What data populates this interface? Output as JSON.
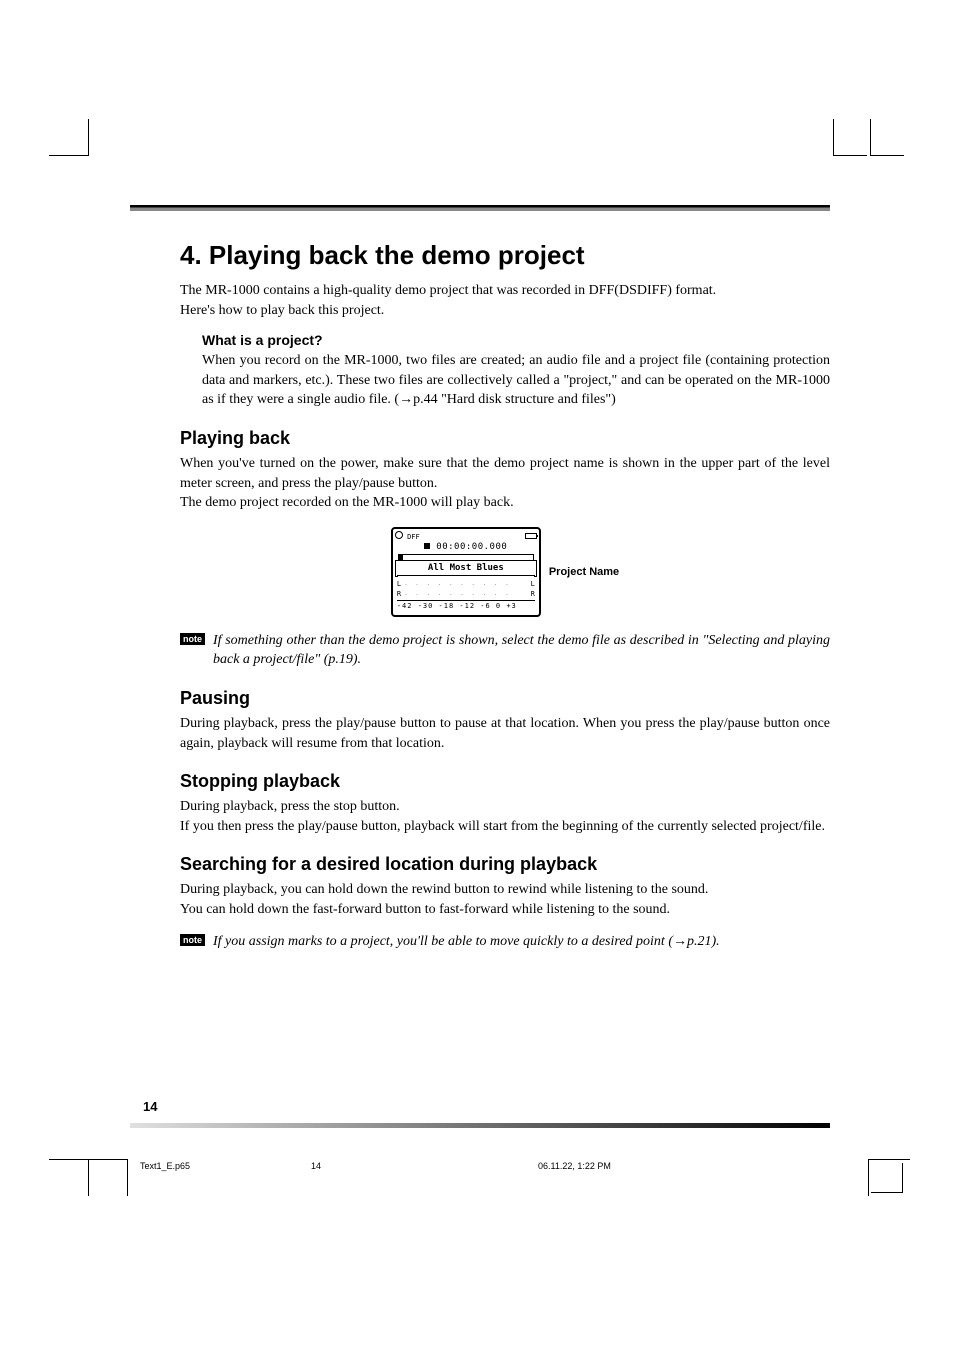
{
  "page": {
    "title": "4. Playing back the demo project",
    "intro_p1": "The MR-1000 contains a high-quality demo project that was recorded in DFF(DSDIFF) format.",
    "intro_p2": "Here's how to play back this project.",
    "number": "14"
  },
  "box_project": {
    "heading": "What is a project?",
    "text": "When you record on the MR-1000, two files are created; an audio file and a project file (containing protection data and markers, etc.). These two files are collectively called a \"project,\" and can be operated on the MR-1000 as if they were a single audio file. (→p.44 \"Hard disk structure and files\")"
  },
  "playing_back": {
    "heading": "Playing back",
    "p1": "When you've turned on the power, make sure that the demo project name is shown in the upper part of the level meter screen, and press the play/pause button.",
    "p2": "The demo project recorded on the MR-1000 will play back."
  },
  "screen": {
    "dff_label": "DFF",
    "counter": "00:00:00.000",
    "project_title": "All Most Blues",
    "ch_l": "L",
    "ch_r": "R",
    "scale": "-42 -30 -18 -12 -6   0 +3",
    "label": "Project Name"
  },
  "note1": {
    "icon": "note",
    "text": "If something other than the demo project is shown, select the demo file as described in \"Selecting and playing back a project/file\" (p.19)."
  },
  "pausing": {
    "heading": "Pausing",
    "text": "During playback, press the play/pause button to pause at that location. When you press the play/pause button once again, playback will resume from that location."
  },
  "stopping": {
    "heading": "Stopping playback",
    "p1": "During playback, press the stop button.",
    "p2": "If you then press the play/pause button, playback will start from the beginning of the currently selected project/file."
  },
  "searching": {
    "heading": "Searching for a desired location during playback",
    "p1": "During playback, you can hold down the rewind button to rewind while listening to the sound.",
    "p2": "You can hold down the fast-forward button to fast-forward while listening to the sound."
  },
  "note2": {
    "icon": "note",
    "text": "If you assign marks to a project, you'll be able to move quickly to a desired point (→p.21)."
  },
  "footer": {
    "file": "Text1_E.p65",
    "page": "14",
    "date": "06.11.22, 1:22 PM"
  }
}
